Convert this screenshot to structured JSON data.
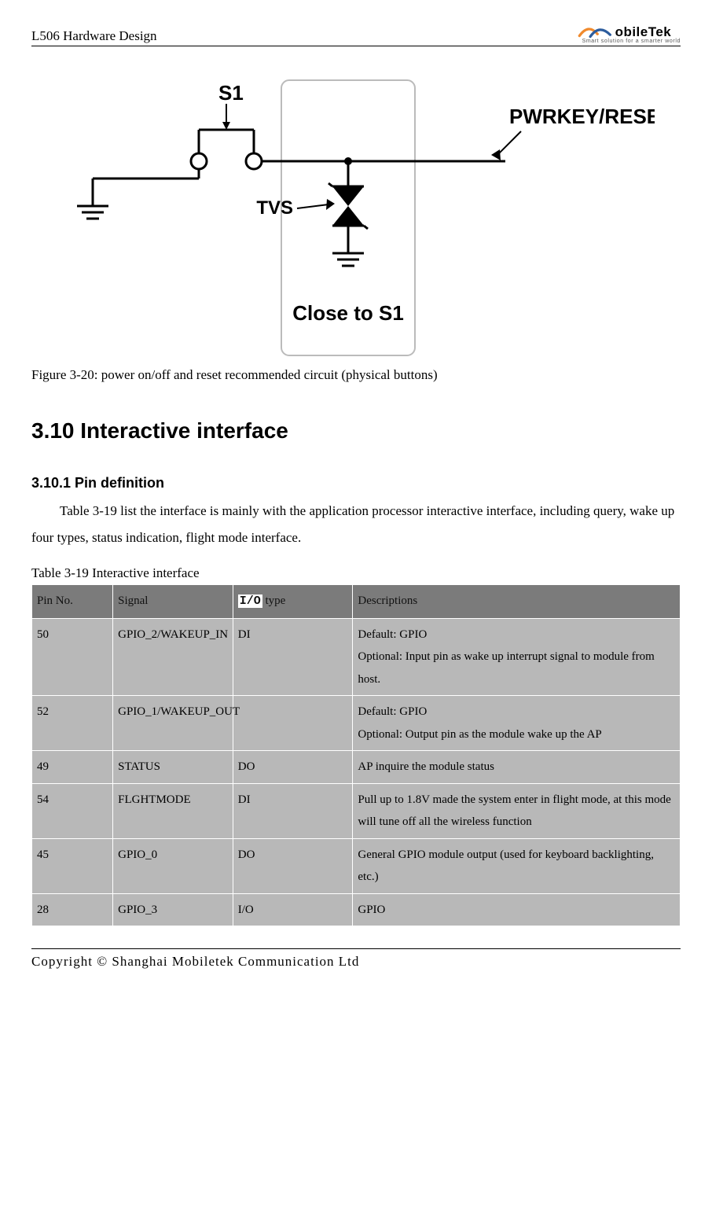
{
  "header": {
    "doc_title": "L506 Hardware Design",
    "logo": {
      "brand": "obileTek",
      "tagline": "Smart solution for a smarter world"
    }
  },
  "figure": {
    "labels": {
      "s1": "S1",
      "tvs": "TVS",
      "close": "Close to S1",
      "pwrkey": "PWRKEY/RESET"
    },
    "caption": "Figure 3-20: power on/off and reset recommended circuit (physical buttons)"
  },
  "section": {
    "heading": "3.10 Interactive interface",
    "sub_heading": "3.10.1 Pin definition",
    "paragraph": "Table 3-19 list the interface is mainly with the application processor interactive interface, including query, wake up four types, status indication, flight mode interface.",
    "table_caption": "Table 3-19 Interactive interface"
  },
  "table": {
    "headers": {
      "pin_no": "Pin No.",
      "signal": "Signal",
      "io_type_code": "I/O",
      "io_type_rest": " type",
      "desc": "Descriptions"
    },
    "rows": [
      {
        "pin": "50",
        "signal": "GPIO_2/WAKEUP_IN",
        "io": "DI",
        "desc": "Default: GPIO\nOptional: Input pin as wake up interrupt signal to module from host."
      },
      {
        "pin": "52",
        "signal": "GPIO_1/WAKEUP_OUT",
        "io": "",
        "desc": "Default: GPIO\nOptional: Output pin as the module wake up the AP"
      },
      {
        "pin": "49",
        "signal": "STATUS",
        "io": "DO",
        "desc": "AP inquire the module status"
      },
      {
        "pin": "54",
        "signal": "FLGHTMODE",
        "io": "DI",
        "desc": "Pull up to 1.8V made the system enter in flight mode, at this mode will tune off all the wireless function"
      },
      {
        "pin": "45",
        "signal": "GPIO_0",
        "io": "DO",
        "desc": "General GPIO module output (used for keyboard backlighting, etc.)"
      },
      {
        "pin": "28",
        "signal": "GPIO_3",
        "io": "I/O",
        "desc": "GPIO"
      }
    ]
  },
  "footer": {
    "copyright": "Copyright © Shanghai Mobiletek Communication Ltd"
  }
}
